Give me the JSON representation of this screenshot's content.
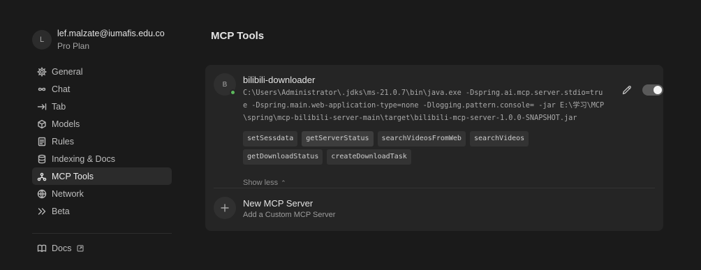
{
  "user": {
    "avatar_initial": "L",
    "email": "lef.malzate@iumafis.edu.co",
    "plan": "Pro Plan"
  },
  "sidebar": {
    "items": [
      {
        "label": "General",
        "icon": "gear-icon"
      },
      {
        "label": "Chat",
        "icon": "infinity-icon"
      },
      {
        "label": "Tab",
        "icon": "tab-arrow-icon"
      },
      {
        "label": "Models",
        "icon": "cube-icon"
      },
      {
        "label": "Rules",
        "icon": "document-icon"
      },
      {
        "label": "Indexing & Docs",
        "icon": "database-icon"
      },
      {
        "label": "MCP Tools",
        "icon": "mcp-network-icon",
        "active": true
      },
      {
        "label": "Network",
        "icon": "globe-icon"
      },
      {
        "label": "Beta",
        "icon": "double-chevron-icon"
      }
    ],
    "docs": {
      "label": "Docs",
      "icon": "book-icon"
    }
  },
  "main": {
    "title": "MCP Tools",
    "server": {
      "avatar_initial": "B",
      "name": "bilibili-downloader",
      "status_color": "#5cb85c",
      "command": "C:\\Users\\Administrator\\.jdks\\ms-21.0.7\\bin\\java.exe -Dspring.ai.mcp.server.stdio=true -Dspring.main.web-application-type=none -Dlogging.pattern.console= -jar E:\\学习\\MCP\\spring\\mcp-bilibili-server-main\\target\\bilibili-mcp-server-1.0.0-SNAPSHOT.jar",
      "tools": [
        "setSessdata",
        "getServerStatus",
        "searchVideosFromWeb",
        "searchVideos",
        "getDownloadStatus",
        "createDownloadTask"
      ],
      "show_less_label": "Show less",
      "enabled": true
    },
    "new_server": {
      "title": "New MCP Server",
      "subtitle": "Add a Custom MCP Server"
    }
  }
}
